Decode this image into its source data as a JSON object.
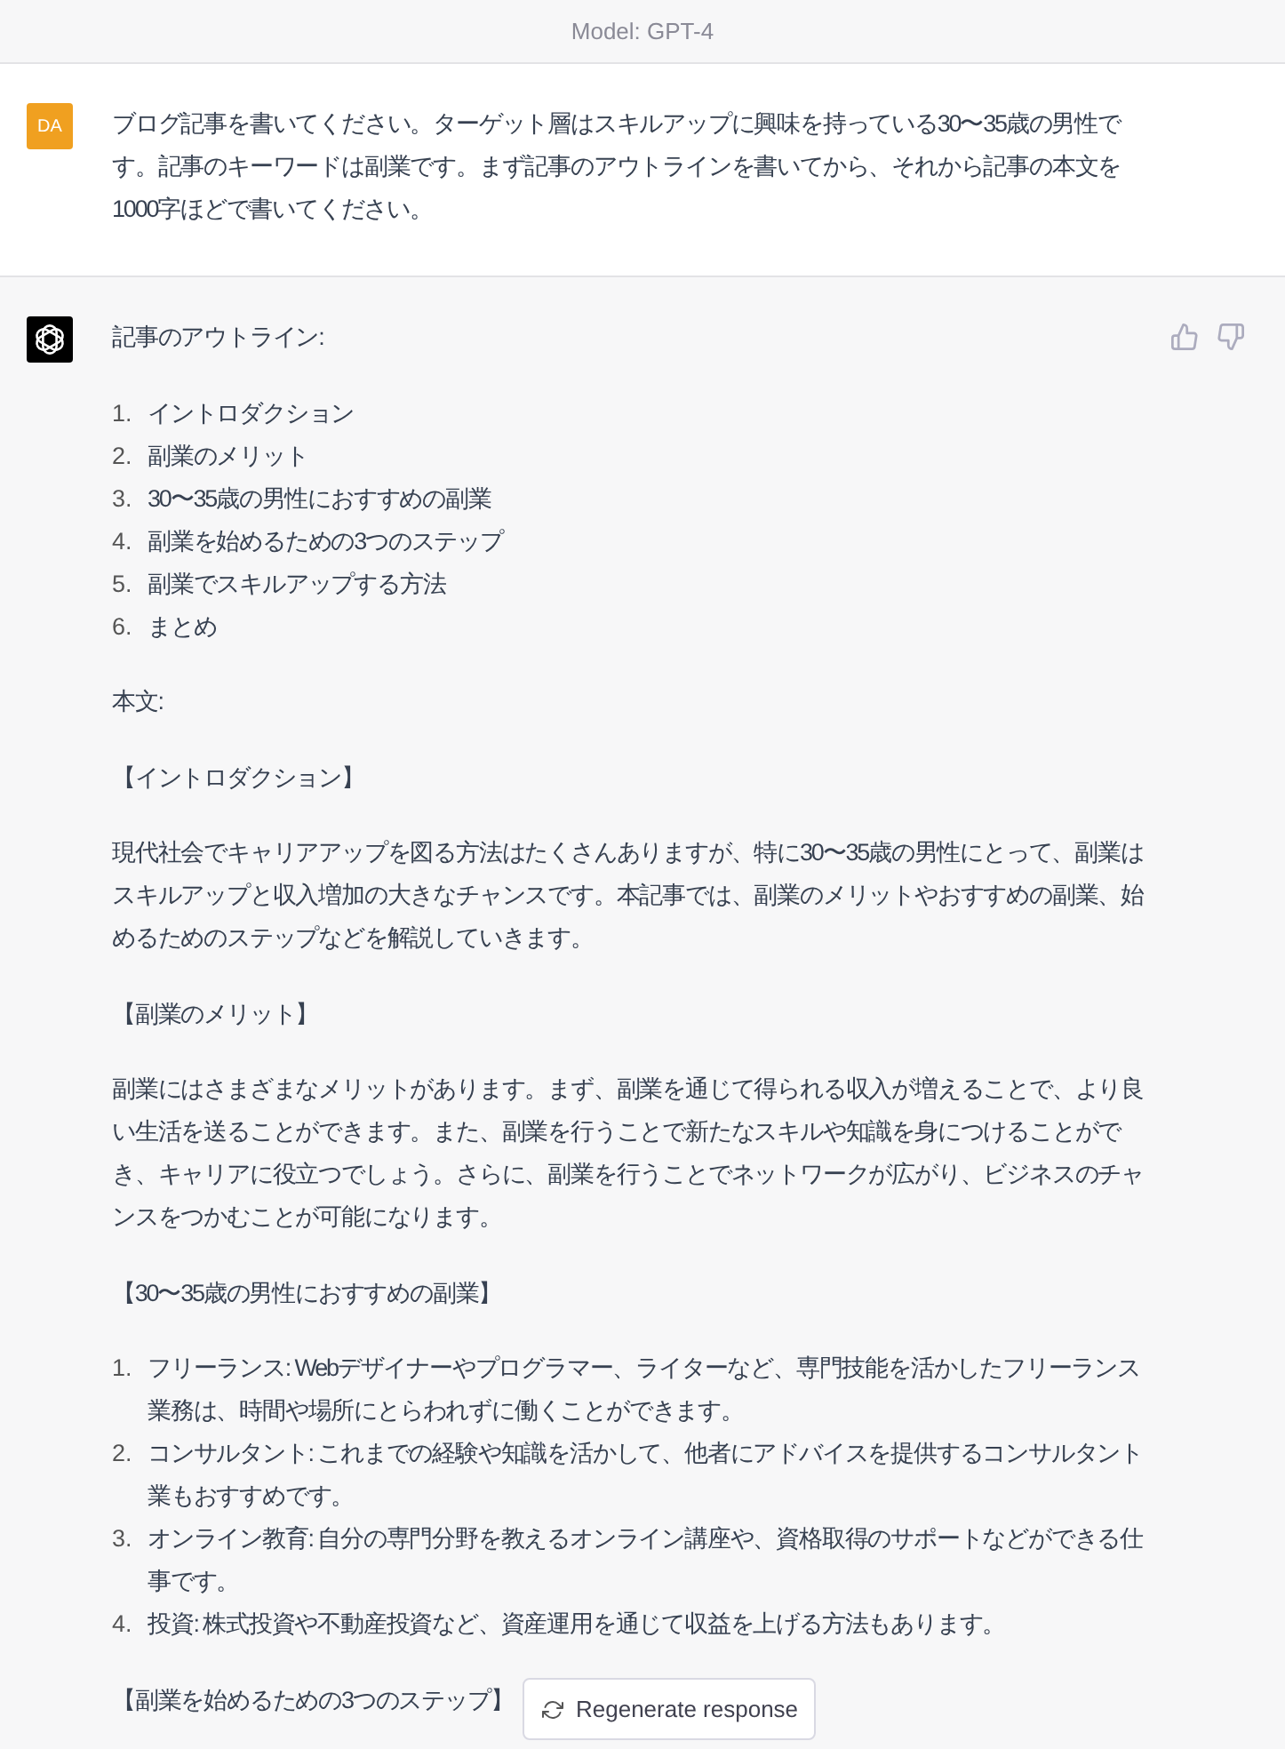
{
  "header": {
    "model_label": "Model: GPT-4"
  },
  "messages": [
    {
      "kind": "user",
      "avatar": "DA",
      "blocks": [
        {
          "kind": "paragraph",
          "text": "ブログ記事を書いてください。ターゲット層はスキルアップに興味を持っている30〜35歳の男性です。記事のキーワードは副業です。まず記事のアウトラインを書いてから、それから記事の本文を1000字ほどで書いてください。"
        }
      ]
    },
    {
      "kind": "assistant",
      "blocks": [
        {
          "kind": "heading",
          "text": "記事のアウトライン:"
        },
        {
          "kind": "ordered_list",
          "items": [
            {
              "number": "1.",
              "text": "イントロダクション"
            },
            {
              "number": "2.",
              "text": "副業のメリット"
            },
            {
              "number": "3.",
              "text": "30〜35歳の男性におすすめの副業"
            },
            {
              "number": "4.",
              "text": "副業を始めるための3つのステップ"
            },
            {
              "number": "5.",
              "text": "副業でスキルアップする方法"
            },
            {
              "number": "6.",
              "text": "まとめ"
            }
          ]
        },
        {
          "kind": "heading",
          "text": "本文:"
        },
        {
          "kind": "heading",
          "text": "【イントロダクション】"
        },
        {
          "kind": "paragraph",
          "text": "現代社会でキャリアアップを図る方法はたくさんありますが、特に30〜35歳の男性にとって、副業はスキルアップと収入増加の大きなチャンスです。本記事では、副業のメリットやおすすめの副業、始めるためのステップなどを解説していきます。"
        },
        {
          "kind": "heading",
          "text": "【副業のメリット】"
        },
        {
          "kind": "paragraph",
          "text": "副業にはさまざまなメリットがあります。まず、副業を通じて得られる収入が増えることで、より良い生活を送ることができます。また、副業を行うことで新たなスキルや知識を身につけることができ、キャリアに役立つでしょう。さらに、副業を行うことでネットワークが広がり、ビジネスのチャンスをつかむことが可能になります。"
        },
        {
          "kind": "heading",
          "text": "【30〜35歳の男性におすすめの副業】"
        },
        {
          "kind": "ordered_list",
          "items": [
            {
              "number": "1.",
              "text": "フリーランス: Webデザイナーやプログラマー、ライターなど、専門技能を活かしたフリーランス業務は、時間や場所にとらわれずに働くことができます。"
            },
            {
              "number": "2.",
              "text": "コンサルタント: これまでの経験や知識を活かして、他者にアドバイスを提供するコンサルタント業もおすすめです。"
            },
            {
              "number": "3.",
              "text": "オンライン教育: 自分の専門分野を教えるオンライン講座や、資格取得のサポートなどができる仕事です。"
            },
            {
              "number": "4.",
              "text": "投資: 株式投資や不動産投資など、資産運用を通じて収益を上げる方法もあります。"
            }
          ]
        },
        {
          "kind": "heading",
          "text": "【副業を始めるための3つのステップ】"
        }
      ]
    }
  ],
  "regenerate_button": {
    "label": "Regenerate response"
  }
}
